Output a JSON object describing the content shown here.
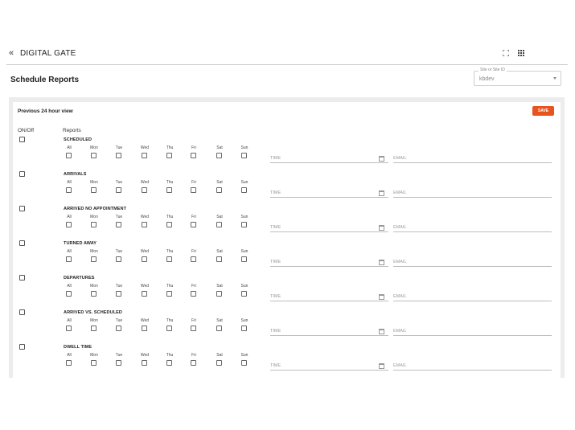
{
  "header": {
    "title": "DIGITAL GATE"
  },
  "page": {
    "title": "Schedule Reports"
  },
  "site_select": {
    "label": "Site or Site ID",
    "value": "kbdev"
  },
  "card": {
    "title": "Previous 24 hour view",
    "save_label": "SAVE",
    "onoff_header": "ON/Off",
    "reports_header": "Reports"
  },
  "days": [
    "All",
    "Mon",
    "Tue",
    "Wed",
    "Thu",
    "Fri",
    "Sat",
    "Sun"
  ],
  "time_placeholder": "TIME",
  "email_placeholder": "EMAIL",
  "reports": [
    {
      "name": "SCHEDULED"
    },
    {
      "name": "ARRIVALS"
    },
    {
      "name": "ARRIVED NO APPOINTMENT"
    },
    {
      "name": "TURNED AWAY"
    },
    {
      "name": "DEPARTURES"
    },
    {
      "name": "ARRIVED VS. SCHEDULED"
    },
    {
      "name": "DWELL TIME"
    }
  ]
}
